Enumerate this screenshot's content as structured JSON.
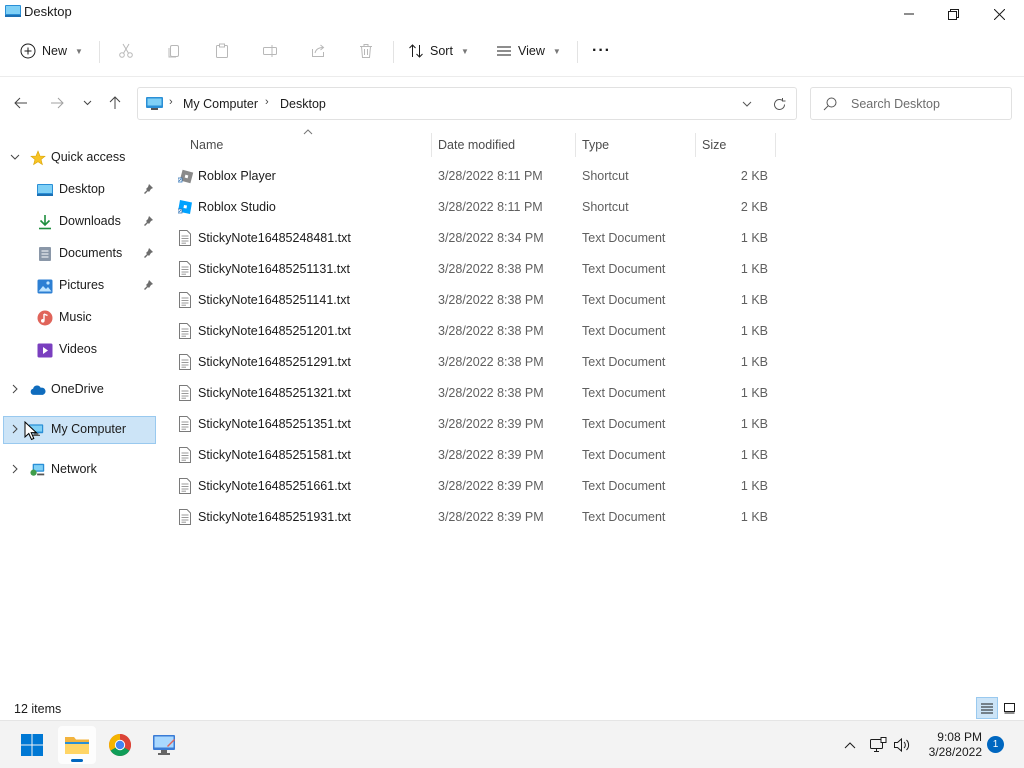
{
  "window": {
    "title": "Desktop"
  },
  "command_bar": {
    "new_label": "New",
    "sort_label": "Sort",
    "view_label": "View",
    "more_label": "···"
  },
  "address": {
    "crumbs": [
      "My Computer",
      "Desktop"
    ]
  },
  "search": {
    "placeholder": "Search Desktop"
  },
  "sidebar": {
    "items": [
      {
        "label": "Quick access",
        "icon": "star-icon"
      },
      {
        "label": "Desktop",
        "icon": "desktop-icon",
        "pinned": true
      },
      {
        "label": "Downloads",
        "icon": "download-icon",
        "pinned": true
      },
      {
        "label": "Documents",
        "icon": "document-icon",
        "pinned": true
      },
      {
        "label": "Pictures",
        "icon": "picture-icon",
        "pinned": true
      },
      {
        "label": "Music",
        "icon": "music-icon"
      },
      {
        "label": "Videos",
        "icon": "video-icon"
      },
      {
        "label": "OneDrive",
        "icon": "cloud-icon"
      },
      {
        "label": "My Computer",
        "icon": "computer-icon",
        "selected": true
      },
      {
        "label": "Network",
        "icon": "network-icon"
      }
    ]
  },
  "columns": {
    "name": "Name",
    "date": "Date modified",
    "type": "Type",
    "size": "Size"
  },
  "files": [
    {
      "name": "Roblox Player",
      "date": "3/28/2022 8:11 PM",
      "type": "Shortcut",
      "size": "2 KB",
      "icon": "roblox-player-icon"
    },
    {
      "name": "Roblox Studio",
      "date": "3/28/2022 8:11 PM",
      "type": "Shortcut",
      "size": "2 KB",
      "icon": "roblox-studio-icon"
    },
    {
      "name": "StickyNote16485248481.txt",
      "date": "3/28/2022 8:34 PM",
      "type": "Text Document",
      "size": "1 KB",
      "icon": "text-file-icon"
    },
    {
      "name": "StickyNote16485251131.txt",
      "date": "3/28/2022 8:38 PM",
      "type": "Text Document",
      "size": "1 KB",
      "icon": "text-file-icon"
    },
    {
      "name": "StickyNote16485251141.txt",
      "date": "3/28/2022 8:38 PM",
      "type": "Text Document",
      "size": "1 KB",
      "icon": "text-file-icon"
    },
    {
      "name": "StickyNote16485251201.txt",
      "date": "3/28/2022 8:38 PM",
      "type": "Text Document",
      "size": "1 KB",
      "icon": "text-file-icon"
    },
    {
      "name": "StickyNote16485251291.txt",
      "date": "3/28/2022 8:38 PM",
      "type": "Text Document",
      "size": "1 KB",
      "icon": "text-file-icon"
    },
    {
      "name": "StickyNote16485251321.txt",
      "date": "3/28/2022 8:38 PM",
      "type": "Text Document",
      "size": "1 KB",
      "icon": "text-file-icon"
    },
    {
      "name": "StickyNote16485251351.txt",
      "date": "3/28/2022 8:39 PM",
      "type": "Text Document",
      "size": "1 KB",
      "icon": "text-file-icon"
    },
    {
      "name": "StickyNote16485251581.txt",
      "date": "3/28/2022 8:39 PM",
      "type": "Text Document",
      "size": "1 KB",
      "icon": "text-file-icon"
    },
    {
      "name": "StickyNote16485251661.txt",
      "date": "3/28/2022 8:39 PM",
      "type": "Text Document",
      "size": "1 KB",
      "icon": "text-file-icon"
    },
    {
      "name": "StickyNote16485251931.txt",
      "date": "3/28/2022 8:39 PM",
      "type": "Text Document",
      "size": "1 KB",
      "icon": "text-file-icon"
    }
  ],
  "status": {
    "item_count": "12 items"
  },
  "taskbar": {
    "time": "9:08 PM",
    "date": "3/28/2022",
    "notification_count": "1"
  },
  "colors": {
    "accent": "#0067c0",
    "selection": "#cce4f7",
    "selection_border": "#99c9ef"
  }
}
